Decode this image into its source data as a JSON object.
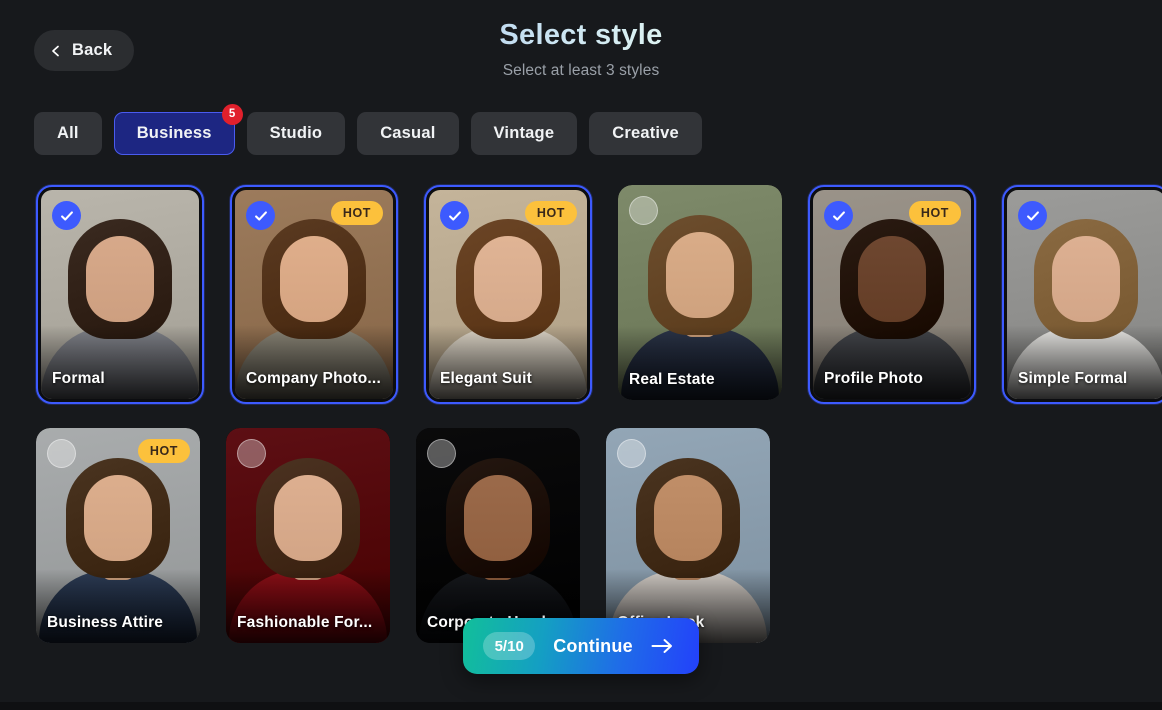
{
  "header": {
    "back_label": "Back",
    "back_icon": "chevron-left-icon",
    "title": "Select style",
    "subtitle": "Select at least 3 styles"
  },
  "filters": {
    "items": [
      {
        "label": "All",
        "active": false,
        "badge": null
      },
      {
        "label": "Business",
        "active": true,
        "badge": "5"
      },
      {
        "label": "Studio",
        "active": false,
        "badge": null
      },
      {
        "label": "Casual",
        "active": false,
        "badge": null
      },
      {
        "label": "Vintage",
        "active": false,
        "badge": null
      },
      {
        "label": "Creative",
        "active": false,
        "badge": null
      }
    ]
  },
  "styles": {
    "hot_label": "HOT",
    "check_icon": "check-icon",
    "cards": [
      {
        "label": "Formal",
        "selected": true,
        "hot": false,
        "colors": {
          "bg": "#b9b5ab",
          "hair": "#3a2a20",
          "face": "#d7a98a",
          "body": "#81838a",
          "neck": "#c49madd"
        }
      },
      {
        "label": "Company Photo...",
        "selected": true,
        "hot": true,
        "colors": {
          "bg": "#9c7b5c",
          "hair": "#5a3a21",
          "face": "#dfae8b",
          "body": "#8a8577",
          "neck": "#cf9f7f"
        }
      },
      {
        "label": "Elegant Suit",
        "selected": true,
        "hot": true,
        "colors": {
          "bg": "#c4b49a",
          "hair": "#6b4526",
          "face": "#e0b495",
          "body": "#ddd5c7",
          "neck": "#d3a384"
        }
      },
      {
        "label": "Real Estate",
        "selected": false,
        "hot": false,
        "colors": {
          "bg": "#7e8a6a",
          "hair": "#6d4e2e",
          "face": "#d9ac88",
          "body": "#2b3447",
          "neck": "#c89c79"
        }
      },
      {
        "label": "Profile Photo",
        "selected": true,
        "hot": true,
        "colors": {
          "bg": "#9a9389",
          "hair": "#2a1b12",
          "face": "#6e4730",
          "body": "#44464b",
          "neck": "#5f3d29"
        }
      },
      {
        "label": "Simple Formal",
        "selected": true,
        "hot": false,
        "colors": {
          "bg": "#9b9b99",
          "hair": "#8a6a42",
          "face": "#ddb092",
          "body": "#e7e6e3",
          "neck": "#cf9f80"
        }
      },
      {
        "label": "Business Attire",
        "selected": false,
        "hot": true,
        "colors": {
          "bg": "#a9acad",
          "hair": "#4a3420",
          "face": "#dcae8d",
          "body": "#2d3c55",
          "neck": "#cb9e7d"
        }
      },
      {
        "label": "Fashionable For...",
        "selected": false,
        "hot": false,
        "colors": {
          "bg": "#5d0f14",
          "hair": "#4b3221",
          "face": "#ddaf90",
          "body": "#8a1018",
          "neck": "#cb9d7e"
        }
      },
      {
        "label": "Corporate Headshot",
        "selected": false,
        "hot": false,
        "colors": {
          "bg": "#0a0a0b",
          "hair": "#241710",
          "face": "#9b6a4a",
          "body": "#17191d",
          "neck": "#8a5d40"
        }
      },
      {
        "label": "Office Look",
        "selected": false,
        "hot": false,
        "colors": {
          "bg": "#93a6b6",
          "hair": "#4a3420",
          "face": "#c08e68",
          "body": "#cfc9c3",
          "neck": "#ae7f5c"
        }
      }
    ]
  },
  "footer": {
    "counter": "5/10",
    "continue_label": "Continue",
    "arrow_icon": "arrow-right-icon"
  }
}
